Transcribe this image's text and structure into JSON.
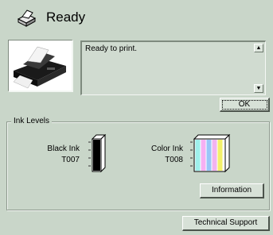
{
  "header": {
    "title": "Ready",
    "icon": "printer-icon"
  },
  "status": {
    "message": "Ready to print."
  },
  "buttons": {
    "ok": "OK",
    "information": "Information",
    "technical_support": "Technical Support"
  },
  "ink_levels": {
    "group_label": "Ink Levels",
    "black": {
      "name": "Black Ink",
      "cartridge": "T007",
      "level": 1.0,
      "color": "#000000"
    },
    "color": {
      "name": "Color Ink",
      "cartridge": "T008",
      "level": 1.0,
      "colors": [
        "#9ef0ec",
        "#f6b0f3",
        "#9ac6f8",
        "#f2b3f0",
        "#f3f06a"
      ]
    }
  }
}
